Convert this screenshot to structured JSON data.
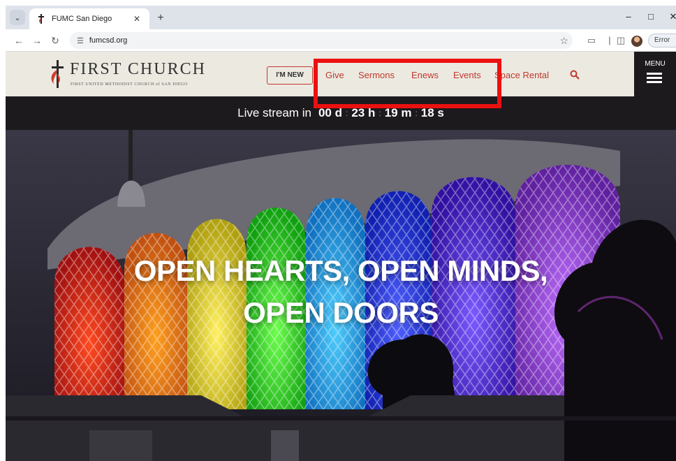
{
  "browser": {
    "tab_title": "FUMC San Diego",
    "url": "fumcsd.org",
    "error_chip": "Error"
  },
  "header": {
    "logo_name": "FIRST CHURCH",
    "logo_tagline": "FIRST UNITED METHODIST CHURCH of SAN DIEGO",
    "im_new_label": "I'M NEW",
    "nav": [
      "Give",
      "Sermons",
      "Enews",
      "Events",
      "Space Rental"
    ],
    "menu_label": "MENU"
  },
  "countdown": {
    "label": "Live stream in",
    "days": "00 d",
    "hours": "23 h",
    "minutes": "19 m",
    "seconds": "18 s",
    "separator": ":"
  },
  "hero": {
    "line1": "OPEN HEARTS, OPEN MINDS,",
    "line2": "OPEN DOORS"
  },
  "icons": {
    "tab_favicon": "cross-flame-icon",
    "search": "search-icon",
    "menu": "hamburger-icon"
  },
  "colors": {
    "accent": "#c0392b",
    "highlight": "#ec1010",
    "header_bg": "#ece9e1"
  }
}
